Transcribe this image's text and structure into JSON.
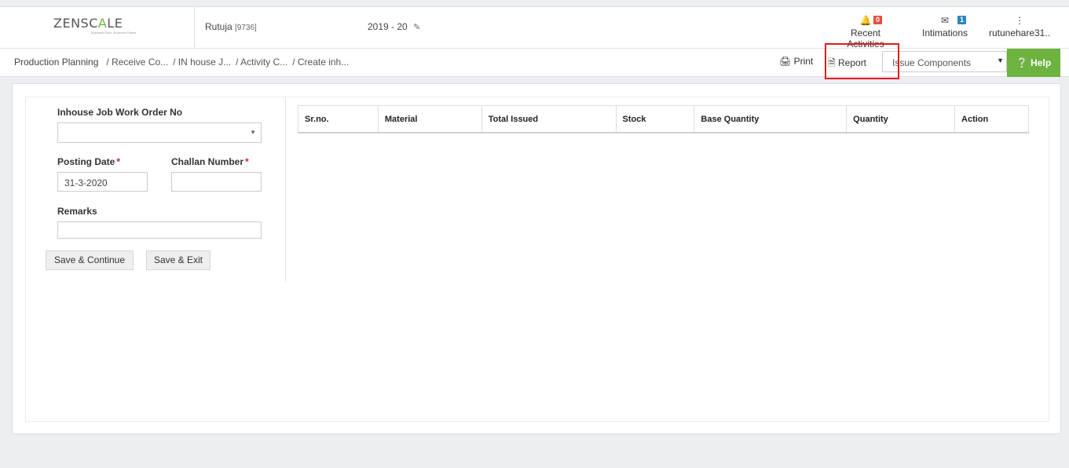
{
  "header": {
    "logo_word_part1": "ZENSC",
    "logo_word_part2": "A",
    "logo_word_part3": "LE",
    "logo_tagline": "Business Ease. Business Peace.",
    "user_name": "Rutuja",
    "user_id": "[9736]",
    "fiscal_year": "2019 - 20",
    "recent_activities": {
      "label": "Recent Activities",
      "count": "0"
    },
    "intimations": {
      "label": "Intimations",
      "count": "1"
    },
    "account": {
      "label": "rutunehare31.."
    }
  },
  "breadcrumb": [
    "Production Planning",
    "/ Receive Co...",
    "/ IN house J...",
    "/ Activity C...",
    "/ Create inh..."
  ],
  "toolbar": {
    "print_label": "Print",
    "report_label": "Report",
    "select_value": "Issue Components",
    "help_label": "Help"
  },
  "form": {
    "order_label": "Inhouse Job Work Order No",
    "order_value": "",
    "posting_date_label": "Posting Date",
    "posting_date_value": "31-3-2020",
    "challan_label": "Challan Number",
    "challan_value": "",
    "remarks_label": "Remarks",
    "remarks_value": "",
    "required_mark": "*",
    "save_continue_label": "Save & Continue",
    "save_exit_label": "Save & Exit"
  },
  "table": {
    "columns": [
      "Sr.no.",
      "Material",
      "Total Issued",
      "Stock",
      "Base Quantity",
      "Quantity",
      "Action"
    ]
  },
  "icons": {
    "bell": "bell-icon",
    "envelope": "envelope-icon",
    "more": "kebab-icon",
    "edit": "edit-icon",
    "print": "print-icon",
    "report": "file-icon",
    "help": "question-circle-icon"
  },
  "colors": {
    "brand_green": "#6cb33f",
    "badge_red": "#e74c3c",
    "badge_blue": "#2e86c1",
    "highlight_red": "#e01b1b"
  }
}
